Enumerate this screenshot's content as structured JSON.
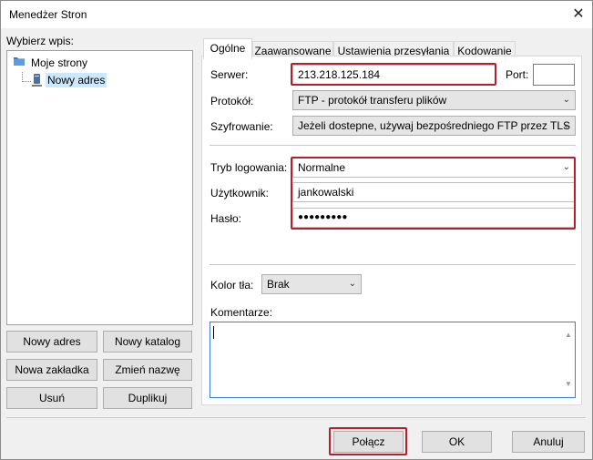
{
  "window": {
    "title": "Menedżer Stron",
    "close_glyph": "✕"
  },
  "left": {
    "select_label": "Wybierz wpis:",
    "tree": {
      "root_label": "Moje strony",
      "child_label": "Nowy adres"
    },
    "buttons": {
      "new_site": "Nowy adres",
      "new_folder": "Nowy katalog",
      "new_bookmark": "Nowa zakładka",
      "rename": "Zmień nazwę",
      "delete": "Usuń",
      "duplicate": "Duplikuj"
    }
  },
  "tabs": [
    "Ogólne",
    "Zaawansowane",
    "Ustawienia przesyłania",
    "Kodowanie"
  ],
  "general": {
    "server_label": "Serwer:",
    "server_value": "213.218.125.184",
    "port_label": "Port:",
    "port_value": "",
    "protocol_label": "Protokół:",
    "protocol_value": "FTP - protokół transferu plików",
    "encryption_label": "Szyfrowanie:",
    "encryption_value": "Jeżeli dostepne, używaj bezpośredniego FTP przez TLS",
    "logon_label": "Tryb logowania:",
    "logon_value": "Normalne",
    "user_label": "Użytkownik:",
    "user_value": "jankowalski",
    "password_label": "Hasło:",
    "password_value": "●●●●●●●●●",
    "bgcolor_label": "Kolor tła:",
    "bgcolor_value": "Brak",
    "comments_label": "Komentarze:"
  },
  "footer": {
    "connect": "Połącz",
    "ok": "OK",
    "cancel": "Anuluj"
  },
  "icons": {
    "folder": "folder-icon",
    "server": "server-icon",
    "dropdown": "chevron-down-icon",
    "close": "close-icon"
  },
  "colors": {
    "highlight": "#b5202a",
    "selection": "#cce8ff"
  }
}
